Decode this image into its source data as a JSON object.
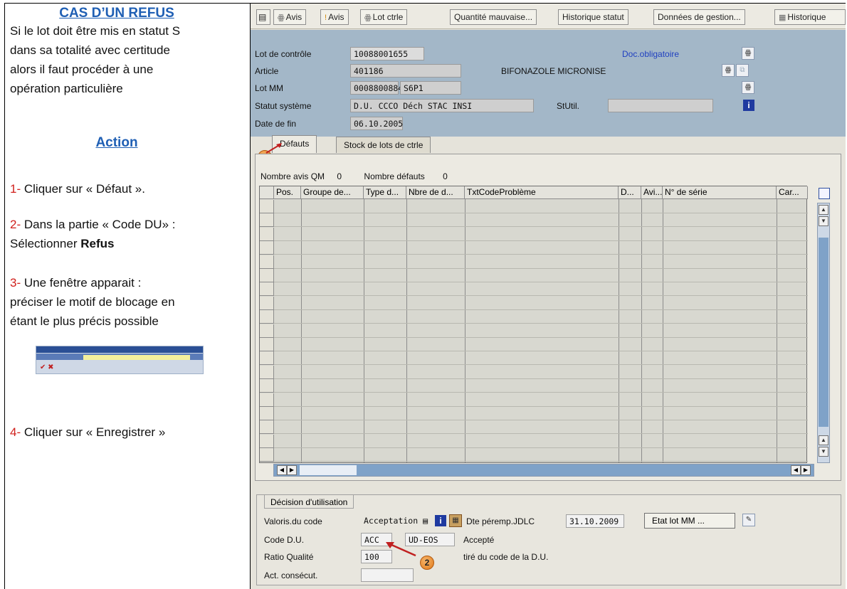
{
  "instructions": {
    "title": "CAS D’UN REFUS",
    "intro_lines": [
      "Si le lot doit être mis en statut S",
      "dans sa totalité avec certitude",
      "alors il faut procéder à une",
      "opération particulière"
    ],
    "action_title": "Action",
    "steps": [
      {
        "num": "1-",
        "lines": [
          "Cliquer sur « Défaut »."
        ]
      },
      {
        "num": "2-",
        "lines": [
          "Dans la partie « Code DU» :",
          "Sélectionner "
        ],
        "bold": "Refus"
      },
      {
        "num": "3-",
        "lines": [
          "Une fenêtre apparait :",
          "préciser le motif de blocage en",
          "étant le plus précis possible"
        ]
      },
      {
        "num": "4-",
        "lines": [
          "Cliquer sur « Enregistrer »"
        ]
      }
    ]
  },
  "toolbar": {
    "buttons": [
      "Avis",
      "Avis",
      "Lot ctrle",
      "Quantité mauvaise...",
      "Historique statut",
      "Données de gestion...",
      "Historique"
    ]
  },
  "header": {
    "lot_controle_label": "Lot de contrôle",
    "lot_controle_value": "10088001655",
    "article_label": "Article",
    "article_value": "401186",
    "article_desc": "BIFONAZOLE MICRONISE",
    "lot_mm_label": "Lot MM",
    "lot_mm_value": "0008800884",
    "lot_mm_extra": "S6P1",
    "statut_label": "Statut système",
    "statut_value": "D.U. CCCO Déch STAC INSI",
    "stutil_label": "StUtil.",
    "date_fin_label": "Date de fin",
    "date_fin_value": "06.10.2005",
    "doc_obligatoire": "Doc.obligatoire"
  },
  "tabs": [
    "Défauts",
    "Stock de lots de ctrle"
  ],
  "defects": {
    "nombre_avis_label": "Nombre avis QM",
    "nombre_avis_value": "0",
    "nombre_defauts_label": "Nombre défauts",
    "nombre_defauts_value": "0",
    "columns": [
      "Pos.",
      "Groupe de...",
      "Type d...",
      "Nbre de d...",
      "TxtCodeProblème",
      "D...",
      "Avi...",
      "N° de série",
      "Car..."
    ]
  },
  "decision": {
    "tab_label": "Décision d'utilisation",
    "valoris_label": "Valoris.du code",
    "valoris_value": "Acceptation",
    "dte_label": "Dte péremp.JDLC",
    "dte_value": "31.10.2009",
    "etat_button": "Etat lot MM ...",
    "code_du_label": "Code D.U.",
    "code_du_value": "ACC",
    "code_group": "UD-EOS",
    "code_text": "Accepté",
    "ratio_label": "Ratio Qualité",
    "ratio_value": "100",
    "ratio_text": "tiré du code de la D.U.",
    "act_label": "Act. consécut."
  },
  "badges": [
    "1",
    "2"
  ],
  "colors": {
    "accent_blue": "#1f5fb4",
    "step_red": "#d0201c",
    "header_bg": "#a3b7c8",
    "badge_orange": "#e07a1a"
  }
}
